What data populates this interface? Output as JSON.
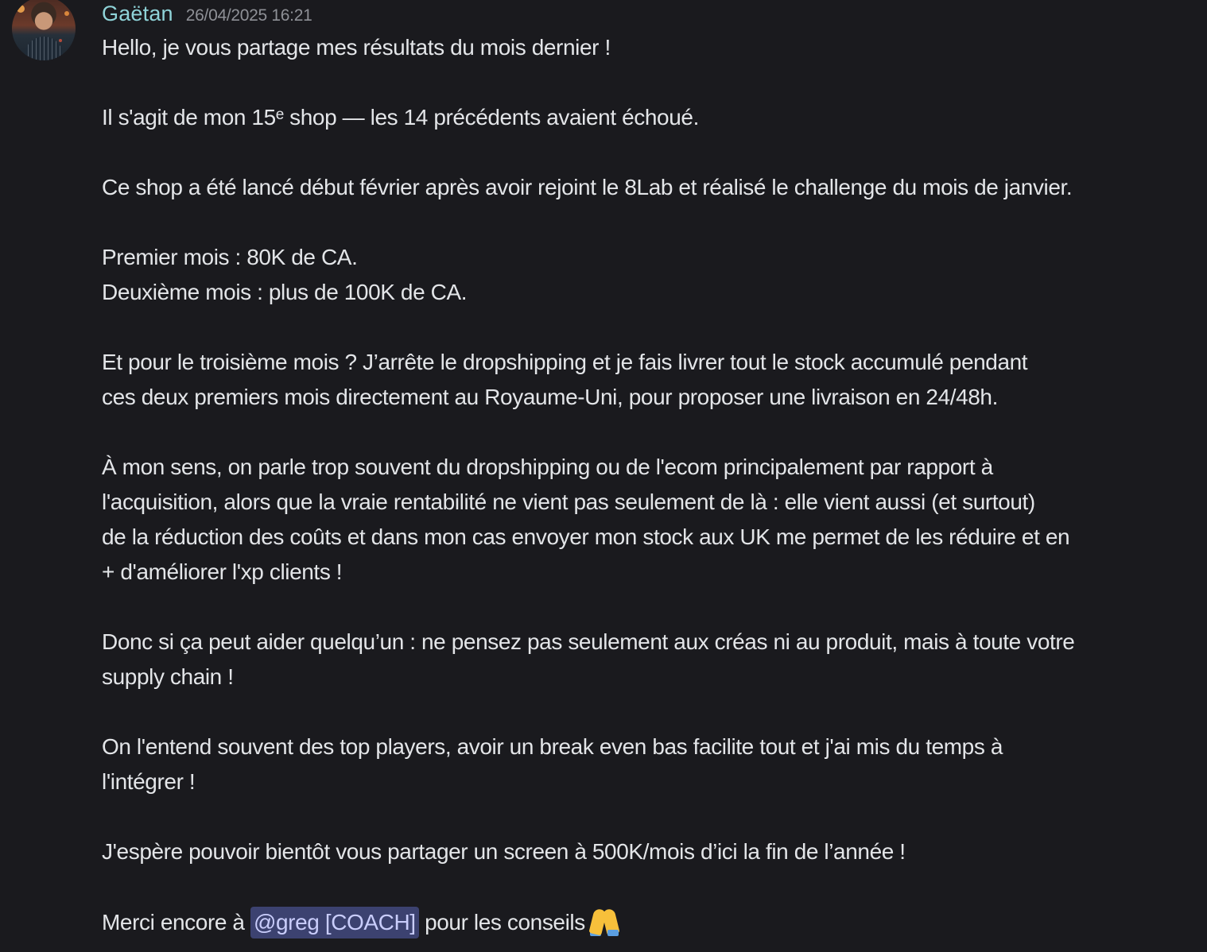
{
  "message": {
    "username": "Gaëtan",
    "timestamp": "26/04/2025 16:21",
    "avatar": "user-avatar-photo",
    "lines": {
      "l1": "Hello, je vous partage mes résultats du mois dernier !",
      "l2": "Il s'agit de mon 15ᵉ shop — les 14 précédents avaient échoué.",
      "l3": "Ce shop a été lancé début février après avoir rejoint le 8Lab et réalisé le challenge du mois de janvier.",
      "l4": "Premier mois : 80K de CA.",
      "l5": "Deuxième mois : plus de 100K de CA.",
      "l6": "Et pour le troisième mois ? J’arrête le dropshipping et je fais livrer tout le stock accumulé pendant",
      "l7": "ces deux premiers mois directement au Royaume-Uni, pour proposer une livraison en 24/48h.",
      "l8": "À mon sens, on parle trop souvent du dropshipping ou de l'ecom principalement par rapport à",
      "l9": "l'acquisition, alors que la vraie rentabilité ne vient pas seulement de là : elle vient aussi (et surtout)",
      "l10": "de la réduction des coûts et dans mon cas envoyer mon stock aux UK me permet de les réduire et en",
      "l11": "+ d'améliorer l'xp clients !",
      "l12": "Donc si ça peut aider quelqu’un : ne pensez pas seulement aux créas ni au produit, mais à toute votre",
      "l13": "supply chain !",
      "l14": "On l'entend souvent des top players, avoir un break even bas facilite tout et j'ai mis du temps à",
      "l15": "l'intégrer !",
      "l16": "J'espère pouvoir bientôt vous partager un screen à 500K/mois d’ici la fin de l’année !",
      "l17_before": "Merci encore à ",
      "l17_mention": "@greg [COACH]",
      "l17_after": " pour les conseils"
    },
    "emoji": "folded-hands-emoji"
  },
  "colors": {
    "background": "#1a1a1e",
    "username": "#8fd3d8",
    "timestamp": "#8e9096",
    "text": "#e3e5e8",
    "mention_bg": "#3c4270",
    "mention_text": "#c9cdfb"
  }
}
